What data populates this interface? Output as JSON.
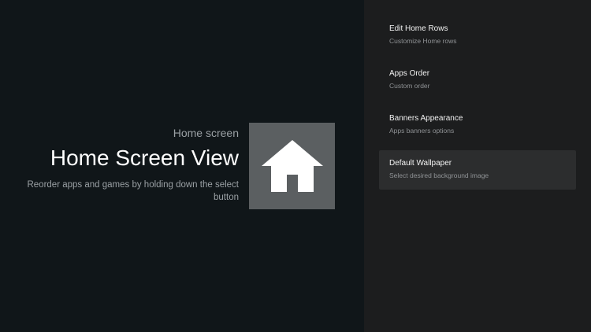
{
  "header": {
    "breadcrumb": "Home screen",
    "title": "Home Screen View",
    "description": "Reorder apps and games by holding down the select button"
  },
  "icon": {
    "name": "home-icon",
    "tile_color": "#5b5f61",
    "glyph_color": "#ffffff"
  },
  "menu": {
    "items": [
      {
        "title": "Edit Home Rows",
        "subtitle": "Customize Home rows"
      },
      {
        "title": "Apps Order",
        "subtitle": "Custom order"
      },
      {
        "title": "Banners Appearance",
        "subtitle": "Apps banners options"
      },
      {
        "title": "Default Wallpaper",
        "subtitle": "Select desired background image",
        "selected": true
      }
    ]
  },
  "colors": {
    "background_left": "#101619",
    "background_right": "#1c1d1e",
    "selected_item": "#2c2d2e"
  }
}
